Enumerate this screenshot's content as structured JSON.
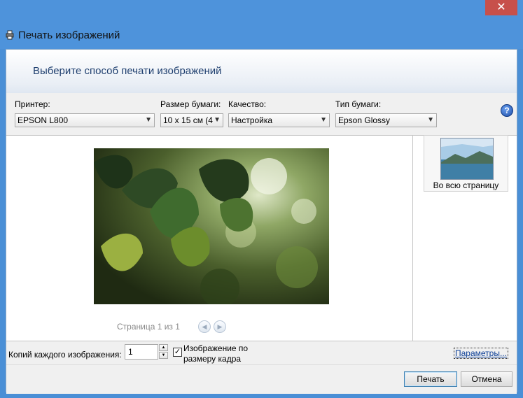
{
  "window": {
    "title": "Печать изображений",
    "close_symbol": "✕"
  },
  "header": {
    "instruction": "Выберите способ печати изображений"
  },
  "controls": {
    "printer": {
      "label": "Принтер:",
      "value": "EPSON L800"
    },
    "paper_size": {
      "label": "Размер бумаги:",
      "value": "10 x 15 см (4"
    },
    "quality": {
      "label": "Качество:",
      "value": "Настройка"
    },
    "paper_type": {
      "label": "Тип бумаги:",
      "value": "Epson Glossy"
    },
    "help_symbol": "?"
  },
  "preview": {
    "page_indicator": "Страница 1 из 1",
    "prev_symbol": "◀",
    "next_symbol": "▶"
  },
  "layouts": [
    {
      "label": "Во всю страницу"
    }
  ],
  "options": {
    "copies_label": "Копий каждого изображения:",
    "copies_value": "1",
    "fit_label": "Изображение по размеру кадра",
    "fit_checked_symbol": "✓",
    "params_link": "Параметры..."
  },
  "buttons": {
    "print": "Печать",
    "cancel": "Отмена"
  },
  "icons": {
    "app": "printer-icon",
    "help": "help-icon",
    "prev": "arrow-left-icon",
    "next": "arrow-right-icon"
  }
}
